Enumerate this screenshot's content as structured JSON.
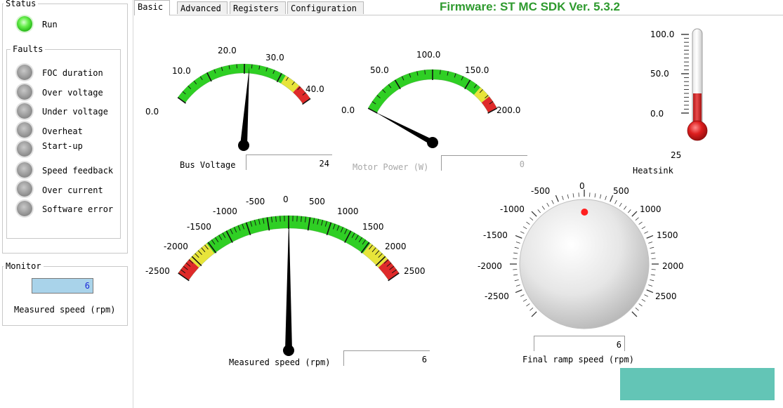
{
  "colors": {
    "firmware_text": "#2e9a2e",
    "gauge_green": "#2fcf24",
    "gauge_yellow": "#e7e43a",
    "gauge_red": "#df2a2a",
    "disabled_text": "#a8a8a8",
    "monitor_box": "#a9d3ea",
    "monitor_value": "#1a28d8",
    "thermometer_red": "#cc2222",
    "knob_dot": "#ff2020"
  },
  "status": {
    "title": "Status",
    "run_label": "Run",
    "run_led": "green"
  },
  "faults": {
    "title": "Faults",
    "items": [
      {
        "label": "FOC duration"
      },
      {
        "label": "Over voltage"
      },
      {
        "label": "Under voltage"
      },
      {
        "label": "Overheat"
      },
      {
        "label": "Start-up"
      },
      {
        "label": "Speed feedback"
      },
      {
        "label": "Over current"
      },
      {
        "label": "Software error"
      }
    ]
  },
  "monitor": {
    "title": "Monitor",
    "value": "6",
    "label": "Measured speed (rpm)"
  },
  "tabs": [
    {
      "label": "Basic",
      "active": true
    },
    {
      "label": "Advanced",
      "active": false
    },
    {
      "label": "Registers",
      "active": false
    },
    {
      "label": "Configuration",
      "active": false
    }
  ],
  "firmware": "Firmware: ST MC SDK Ver. 5.3.2",
  "gauges": {
    "bus_voltage": {
      "caption": "Bus Voltage",
      "readout": "24",
      "tick_labels": [
        "0.0",
        "10.0",
        "20.0",
        "30.0",
        "40.0"
      ],
      "min": 0,
      "max": 45,
      "value": 24
    },
    "motor_power": {
      "caption": "Motor Power (W)",
      "readout": "0",
      "tick_labels": [
        "0.0",
        "50.0",
        "100.0",
        "150.0",
        "200.0"
      ],
      "min": 0,
      "max": 200,
      "value": 0
    },
    "measured_speed": {
      "caption": "Measured speed (rpm)",
      "readout": "6",
      "tick_labels": [
        "-2500",
        "-2000",
        "-1500",
        "-1000",
        "-500",
        "0",
        "500",
        "1000",
        "1500",
        "2000",
        "2500"
      ],
      "min": -3000,
      "max": 3000,
      "value": 6
    }
  },
  "thermometer": {
    "caption": "Heatsink",
    "value_label": "25",
    "tick_labels": [
      "100.0",
      "50.0",
      "0.0"
    ],
    "min": 0,
    "max": 100,
    "value": 25
  },
  "knob": {
    "caption": "Final ramp speed (rpm)",
    "readout": "6",
    "tick_labels": [
      "-500",
      "0",
      "500",
      "-1000",
      "1000",
      "-1500",
      "1500",
      "-2000",
      "2000",
      "-2500",
      "2500"
    ],
    "min": -3000,
    "max": 3000,
    "value": 6
  }
}
